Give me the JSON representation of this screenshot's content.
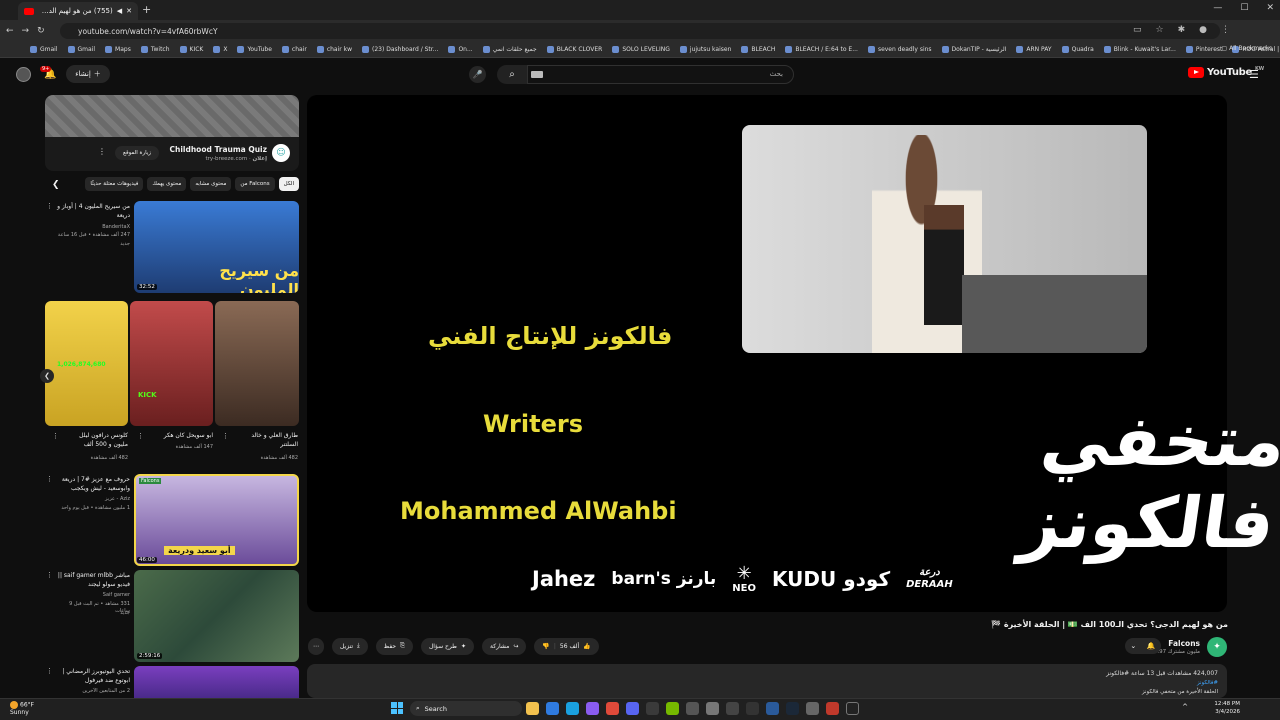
{
  "browser": {
    "tab_title": "(755) من هو لهيم الدجى؟ ت",
    "url": "youtube.com/watch?v=4vfA60rbWcY",
    "all_bookmarks": "All Bookmarks",
    "bookmarks": [
      "Gmail",
      "Gmail",
      "Maps",
      "Twitch",
      "KICK",
      "X",
      "YouTube",
      "chair",
      "chair kw",
      "(23) Dashboard / Str...",
      "On...",
      "جميع حلقات انمي",
      "BLACK CLOVER",
      "SOLO LEVELING",
      "jujutsu kaisen",
      "BLEACH",
      "BLEACH / E:64 to E...",
      "seven deadly sins",
      "DokanTIP - الرئيسية",
      "ARN PAY",
      "Quadra",
      "Blink - Kuwait's Lar...",
      "Pinterest",
      "ROG Astral | Gamin..."
    ]
  },
  "header": {
    "notif_count": "9+",
    "create_label": "إنشاء",
    "search_placeholder": "بحث",
    "logo": "YouTube",
    "country": "KW"
  },
  "ad": {
    "title": "Childhood Trauma Quiz",
    "sponsor": "إعلان",
    "domain": "try-breeze.com",
    "button": "زيارة الموقع"
  },
  "chips": [
    "الكل",
    "من Falcons",
    "محتوى مشابه",
    "محتوى يهمك",
    "فيديوهات معتلة حديثًا"
  ],
  "thumb_texts": {
    "v1_overlay": "من سيريح المليون",
    "s1_overlay": "1,026,874,680",
    "s2_overlay": "KICK",
    "v2_overlay": "أبو سعيد ودريعة",
    "v2_logo": "Falcons"
  },
  "videos": [
    {
      "title": "من سيريح المليون 4 | أوباز و دريعة",
      "channel": "BanderitaX",
      "meta": "247 ألف مشاهدة • قبل 16 ساعة",
      "badge": "جديد",
      "duration": "32:52"
    },
    {
      "title": "حروف مع عزيز #7 | دريعة وابوسعيد - ليش ويكجب",
      "channel": "Aziz - عزيز",
      "meta": "1 مليون مشاهدة • قبل يوم واحد",
      "badge": "",
      "duration": "46:00"
    },
    {
      "title": "مباشر saif gamer mlbb || فيديو سولو ليجند",
      "channel": "Saif gamer",
      "meta": "331 مشاهد • تم البث قبل 9 ساعات",
      "badge": "جديد",
      "duration": "2:59:16"
    },
    {
      "title": "تحدي اليوتيوبرز الرمضاني | ابوتوع ضد فيرفول",
      "channel": "",
      "meta": "2 من المتابعين الآخرين",
      "badge": "",
      "duration": ""
    }
  ],
  "shorts": [
    {
      "title": "طارق العلي و خالد السلتنر",
      "views": "482 ألف مشاهدة"
    },
    {
      "title": "ابو سويحل كان هكر",
      "views": "147 ألف مشاهدة"
    },
    {
      "title": "كلونس درافون ليلل مليون و 500 ألف",
      "views": "482 ألف مشاهدة"
    }
  ],
  "video_frame": {
    "credit_ar": "فالكونز للإنتاج الفني",
    "credit_role": "Writers",
    "credit_name": "Mohammed AlWahbi",
    "calligraphy": "متخفي فالكونز",
    "sponsors": {
      "jahez": "Jahez",
      "barns": "barn's بارنز",
      "neo": "NEO",
      "kudu": "KUDU كودو",
      "deraah_ar": "درعة",
      "deraah": "DERAAH"
    }
  },
  "watch": {
    "title": "من هو لهيم الدجى؟ تحدي الـ100 الف 💵 | الحلقة الأخيرة 🏁",
    "channel_name": "Falcons",
    "subscribers": "3.97 مليون مشترك",
    "likes": "56 ألف",
    "share": "مشاركة",
    "ask": "طرح سؤال",
    "save": "حفظ",
    "download": "تنزيل",
    "desc_views": "424,007 مشاهدات قبل 13 ساعة #فالكونز",
    "desc_tags": "#فالكونز",
    "desc_line": "الحلقة الأخيرة من متخفي فالكونز"
  },
  "taskbar": {
    "temp": "66°F",
    "condition": "Sunny",
    "search": "Search",
    "time": "12:48 PM",
    "date": "3/4/2026"
  },
  "colors": {
    "accent_red": "#ff0000",
    "credit_yellow": "#e8dc3b",
    "link_blue": "#3ea6ff"
  }
}
